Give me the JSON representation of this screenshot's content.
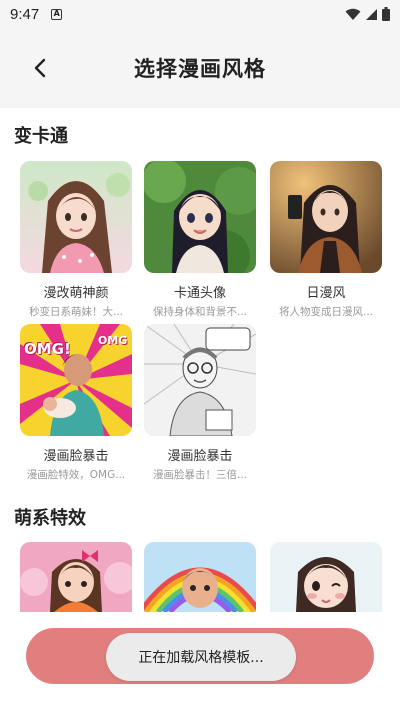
{
  "status_bar": {
    "time": "9:47",
    "notification_icon": "a-box-icon",
    "wifi_icon": "wifi-icon",
    "signal_icon": "signal-icon",
    "battery_icon": "battery-icon"
  },
  "header": {
    "back_icon": "chevron-left-icon",
    "title": "选择漫画风格"
  },
  "sections": [
    {
      "title": "变卡通",
      "cards": [
        {
          "title": "漫改萌神颜",
          "desc": "秒变日系萌妹！大..."
        },
        {
          "title": "卡通头像",
          "desc": "保持身体和背景不..."
        },
        {
          "title": "日漫风",
          "desc": "将人物变成日漫风..."
        },
        {
          "title": "漫画脸暴击",
          "desc": "漫画脸特效，OMG..."
        },
        {
          "title": "漫画脸暴击",
          "desc": "漫画脸暴击！三倍..."
        }
      ]
    },
    {
      "title": "萌系特效",
      "cards": [
        {
          "title": "",
          "desc": ""
        },
        {
          "title": "",
          "desc": ""
        },
        {
          "title": "",
          "desc": ""
        }
      ]
    }
  ],
  "thumb_text": {
    "omg1": "OMG!",
    "omg2": "OMG"
  },
  "toast": {
    "message": "正在加载风格模板..."
  },
  "colors": {
    "accent": "#e07f7e",
    "background": "#ffffff",
    "header_bg": "#f5f5f5"
  }
}
